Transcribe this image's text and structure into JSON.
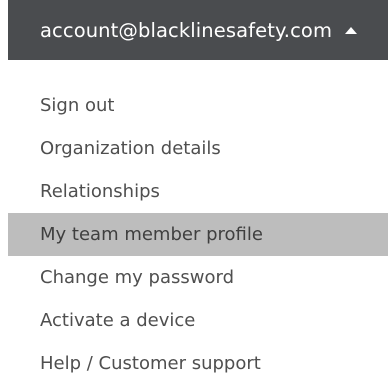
{
  "header": {
    "account_email": "account@blacklinesafety.com",
    "caret_icon": "caret-up-icon",
    "background_color": "#4a4c4f",
    "text_color": "#ffffff"
  },
  "menu": {
    "items": [
      {
        "label": "Sign out"
      },
      {
        "label": "Organization details"
      },
      {
        "label": "Relationships"
      },
      {
        "label": "My team member profile"
      },
      {
        "label": "Change my password"
      },
      {
        "label": "Activate a device"
      },
      {
        "label": "Help / Customer support"
      }
    ],
    "active_item": "My team member profile",
    "active_background_color": "#bdbdbd"
  }
}
